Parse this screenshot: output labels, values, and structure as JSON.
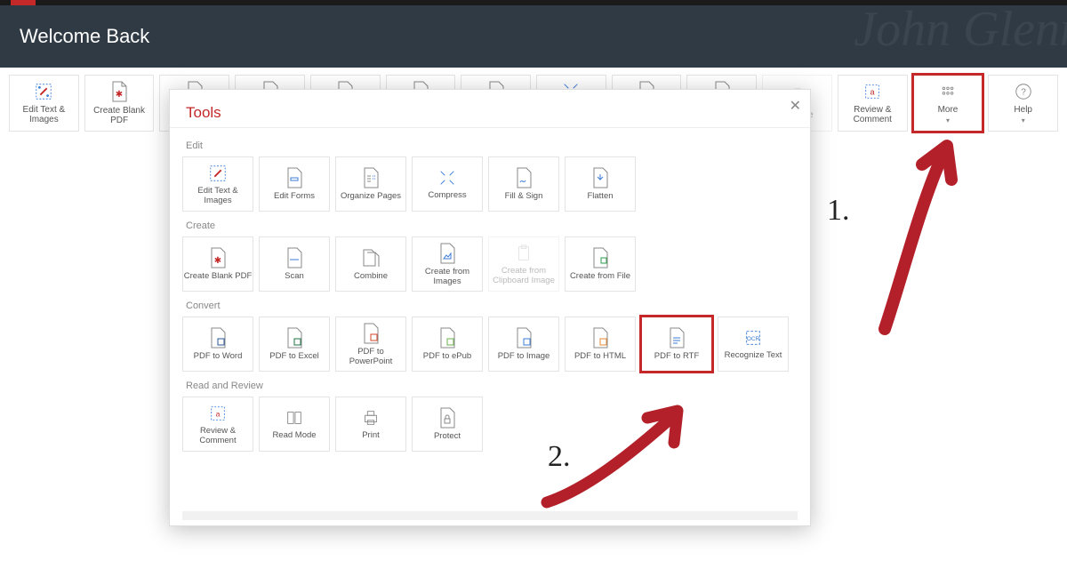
{
  "banner": {
    "title": "Welcome Back"
  },
  "toolbar": {
    "edit_text": "Edit Text & Images",
    "create_blank": "Create Blank PDF",
    "signed_image_frag": "d Image",
    "review": "Review & Comment",
    "more": "More",
    "help": "Help"
  },
  "modal": {
    "title": "Tools",
    "sections": {
      "edit": "Edit",
      "create": "Create",
      "convert": "Convert",
      "read": "Read and Review"
    },
    "edit": [
      "Edit Text & Images",
      "Edit Forms",
      "Organize Pages",
      "Compress",
      "Fill & Sign",
      "Flatten"
    ],
    "create": [
      "Create Blank PDF",
      "Scan",
      "Combine",
      "Create from Images",
      "Create from Clipboard Image",
      "Create from File"
    ],
    "convert": [
      "PDF to Word",
      "PDF to Excel",
      "PDF to PowerPoint",
      "PDF to ePub",
      "PDF to Image",
      "PDF to HTML",
      "PDF to RTF",
      "Recognize Text"
    ],
    "read": [
      "Review & Comment",
      "Read Mode",
      "Print",
      "Protect"
    ]
  },
  "annotations": {
    "one": "1.",
    "two": "2."
  }
}
